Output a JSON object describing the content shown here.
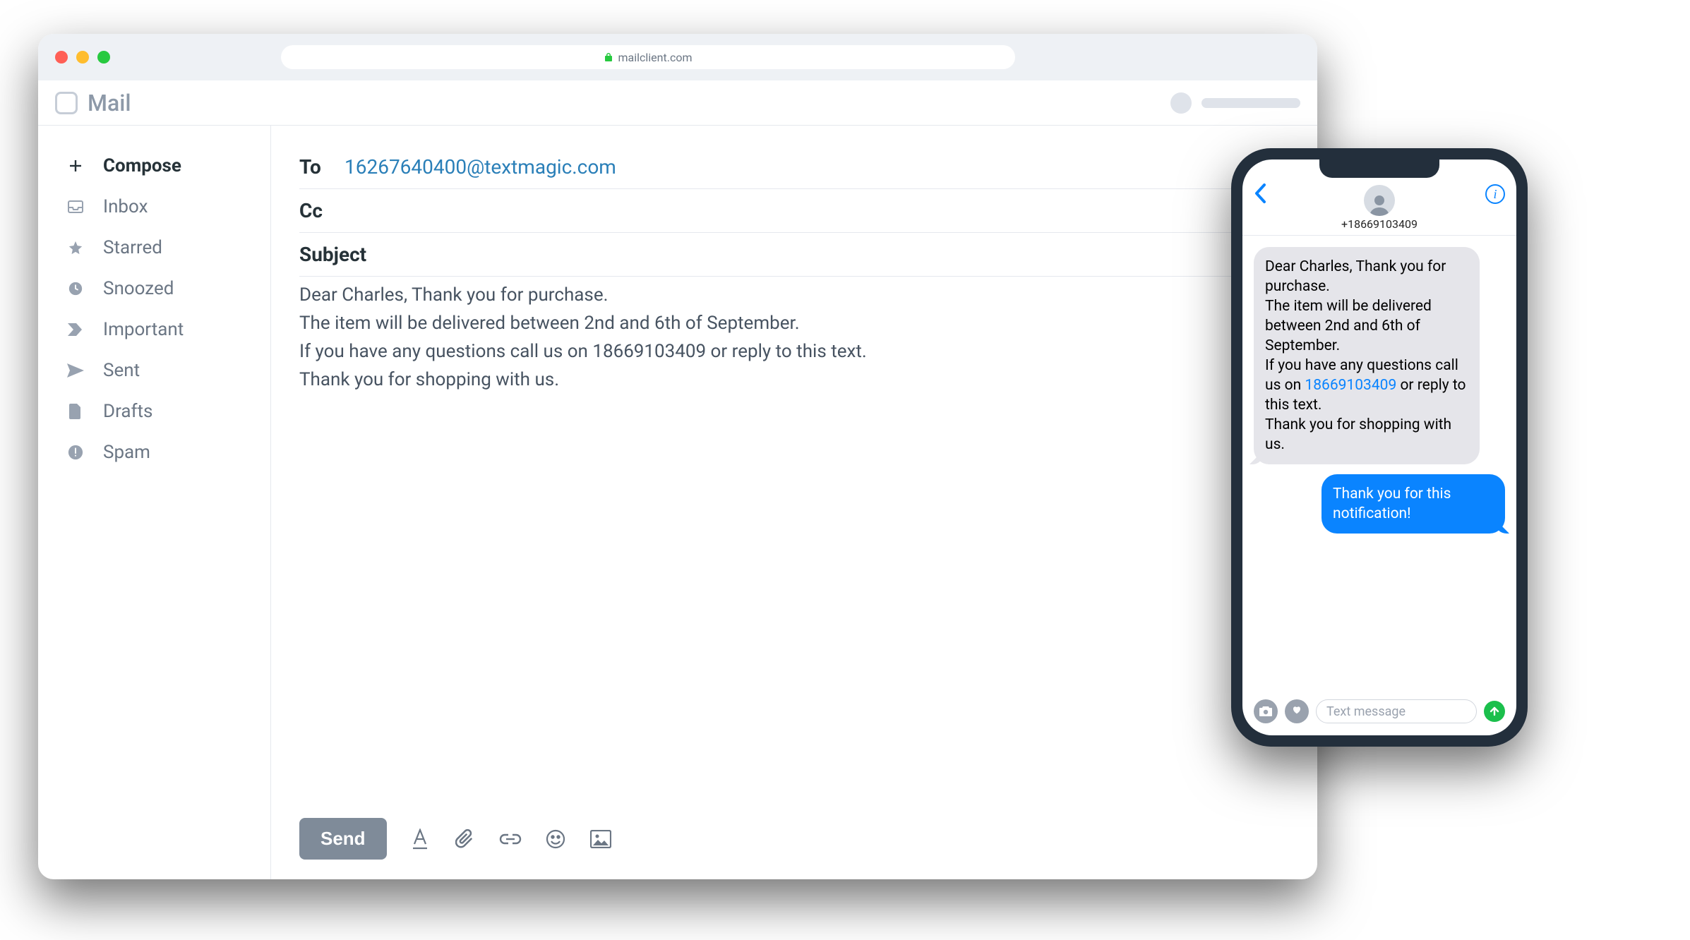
{
  "browser": {
    "url_host": "mailclient.com"
  },
  "app": {
    "title": "Mail"
  },
  "sidebar": {
    "items": [
      {
        "label": "Compose",
        "icon": "plus-icon",
        "active": true
      },
      {
        "label": "Inbox",
        "icon": "inbox-icon"
      },
      {
        "label": "Starred",
        "icon": "star-icon"
      },
      {
        "label": "Snoozed",
        "icon": "clock-icon"
      },
      {
        "label": "Important",
        "icon": "chevron-right-icon"
      },
      {
        "label": "Sent",
        "icon": "send-icon"
      },
      {
        "label": "Drafts",
        "icon": "file-icon"
      },
      {
        "label": "Spam",
        "icon": "alert-icon"
      }
    ]
  },
  "compose": {
    "to_label": "To",
    "to_value": "16267640400@textmagic.com",
    "cc_label": "Cc",
    "subject_label": "Subject",
    "body": "Dear Charles, Thank you for purchase.\nThe item will be delivered between 2nd and 6th of September.\nIf you have any questions call us on 18669103409 or reply to this text.\nThank you for shopping with us.",
    "send_label": "Send"
  },
  "phone": {
    "contact_number": "+18669103409",
    "incoming_segments": [
      {
        "t": "Dear Charles, Thank you for purchase."
      },
      {
        "t": "The item will be delivered between 2nd and 6th of September."
      },
      {
        "t": "If you have any questions call us on "
      },
      {
        "t": "18669103409",
        "link": true
      },
      {
        "t": " or reply to this text."
      },
      {
        "t": "Thank you for shopping with us."
      }
    ],
    "outgoing": "Thank you for this notification!",
    "input_placeholder": "Text message"
  }
}
